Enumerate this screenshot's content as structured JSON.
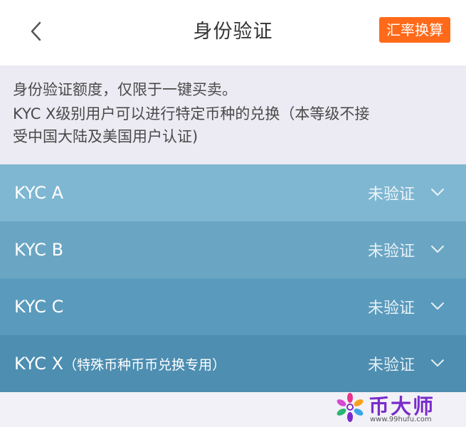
{
  "header": {
    "title": "身份验证",
    "rate_button": "汇率换算"
  },
  "notice": {
    "line1": "身份验证额度，仅限于一键买卖。",
    "line2": "KYC X级别用户可以进行特定币种的兑换（本等级不接",
    "line3": "受中国大陆及美国用户认证)"
  },
  "kyc_levels": [
    {
      "label": "KYC A",
      "sub": "",
      "status": "未验证"
    },
    {
      "label": "KYC B",
      "sub": "",
      "status": "未验证"
    },
    {
      "label": "KYC C",
      "sub": "",
      "status": "未验证"
    },
    {
      "label": "KYC X",
      "sub": "（特殊币种币币兑换专用）",
      "status": "未验证"
    }
  ],
  "watermark": {
    "brand": "币大师",
    "url": "www.99hufu.com"
  },
  "icons": {
    "back": "chevron-left-icon",
    "expand": "chevron-down-icon",
    "logo": "flower-logo-icon"
  },
  "colors": {
    "accent": "#ff6a1a",
    "row1": "#7fb7d2",
    "row2": "#6aa6c4",
    "row3": "#5a9bbd",
    "row4": "#4d8eb1"
  }
}
